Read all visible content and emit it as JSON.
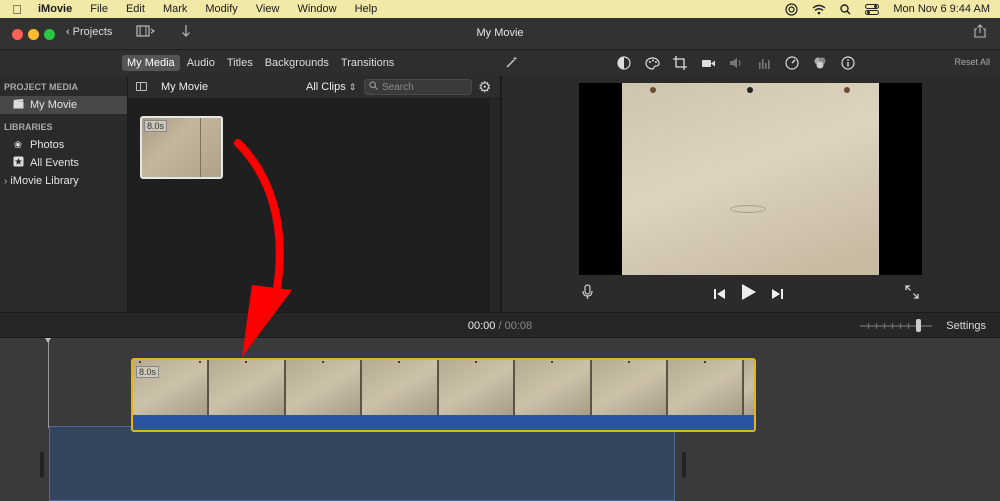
{
  "menubar": {
    "app": "iMovie",
    "items": [
      "File",
      "Edit",
      "Mark",
      "Modify",
      "View",
      "Window",
      "Help"
    ],
    "datetime": "Mon Nov 6  9:44 AM"
  },
  "window": {
    "title": "My Movie",
    "projects_label": "Projects"
  },
  "media_tabs": [
    "My Media",
    "Audio",
    "Titles",
    "Backgrounds",
    "Transitions"
  ],
  "inspector": {
    "reset_all": "Reset All"
  },
  "sidebar": {
    "project_media_header": "PROJECT MEDIA",
    "project_item": "My Movie",
    "libraries_header": "LIBRARIES",
    "library_items": [
      "Photos",
      "All Events"
    ],
    "library_root": "iMovie Library"
  },
  "browser": {
    "title": "My Movie",
    "filter": "All Clips",
    "search_placeholder": "Search",
    "clip_duration": "8.0s"
  },
  "timeline": {
    "current_time": "00:00",
    "separator": "/",
    "total_time": "00:08",
    "settings_label": "Settings",
    "clip_duration": "8.0s"
  },
  "colors": {
    "menubar_bg": "#f0e9a8",
    "clip_selection": "#e2b515",
    "audio_track": "#2a55a5",
    "annotation_arrow": "#ff0000"
  }
}
